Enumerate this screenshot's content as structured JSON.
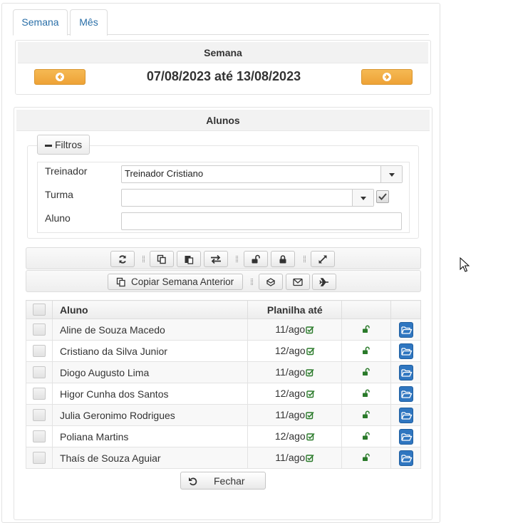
{
  "tabs": [
    {
      "label": "Semana"
    },
    {
      "label": "Mês"
    }
  ],
  "week_panel": {
    "title": "Semana",
    "range": "07/08/2023 até 13/08/2023"
  },
  "students_panel": {
    "title": "Alunos",
    "filters_label": "Filtros",
    "filters": {
      "trainer_label": "Treinador",
      "trainer_value": "Treinador Cristiano",
      "class_label": "Turma",
      "class_value": "",
      "student_label": "Aluno",
      "student_value": ""
    },
    "copy_week_label": "Copiar Semana Anterior",
    "table": {
      "col_student": "Aluno",
      "col_sheet": "Planilha até",
      "rows": [
        {
          "name": "Aline de Souza Macedo",
          "date": "11/ago"
        },
        {
          "name": "Cristiano da Silva Junior",
          "date": "12/ago"
        },
        {
          "name": "Diogo Augusto Lima",
          "date": "11/ago"
        },
        {
          "name": "Higor Cunha dos Santos",
          "date": "12/ago"
        },
        {
          "name": "Julia Geronimo Rodrigues",
          "date": "11/ago"
        },
        {
          "name": "Poliana Martins",
          "date": "12/ago"
        },
        {
          "name": "Thaís de Souza Aguiar",
          "date": "11/ago"
        }
      ]
    },
    "close_label": "Fechar"
  },
  "colors": {
    "accent_orange": "#eea236",
    "link_blue": "#2a6fa8",
    "date_green": "#2a7a2a",
    "folder_blue": "#2f76c0"
  },
  "icons": {
    "prev": "arrow-left-circle-icon",
    "next": "arrow-right-circle-icon",
    "refresh": "refresh-icon",
    "copy": "copy-icon",
    "paste": "paste-icon",
    "swap": "swap-arrows-icon",
    "unlock": "unlock-icon",
    "lock": "lock-icon",
    "expand": "expand-icon",
    "copy_week": "copy-icon",
    "dropbox": "dropbox-icon",
    "envelope": "envelope-icon",
    "plane": "plane-icon",
    "row_lock": "unlock-icon",
    "row_folder": "folder-open-icon",
    "close": "undo-icon"
  }
}
